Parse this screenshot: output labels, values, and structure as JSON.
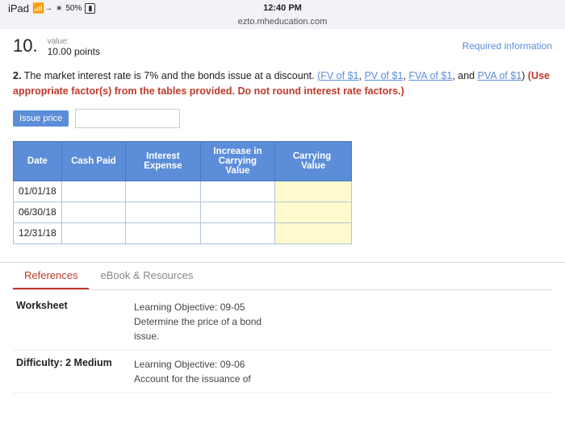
{
  "statusBar": {
    "left": "iPad",
    "time": "12:40 PM",
    "url": "ezto.mheducation.com",
    "battery": "50%",
    "wifiIcon": "wifi",
    "batteryIcon": "battery"
  },
  "question": {
    "number": "10.",
    "valueLabel": "value:",
    "points": "10.00 points",
    "requiredInfo": "Required information",
    "body": "2. The market interest rate is 7% and the bonds issue at a discount.",
    "links": [
      "(FV of $1",
      "PV of $1",
      "FVA of $1",
      "PVA of $1)"
    ],
    "warning": "(Use appropriate factor(s) from the tables provided. Do not round interest rate factors.)",
    "issuePriceLabel": "Issue price",
    "issuePricePlaceholder": ""
  },
  "table": {
    "headers": [
      "Date",
      "Cash Paid",
      "Interest\nExpense",
      "Increase in\nCarrying Value",
      "Carrying  Value"
    ],
    "rows": [
      {
        "date": "01/01/18",
        "cashPaid": "",
        "interestExpense": "",
        "increaseCarrying": "",
        "carryingValue": ""
      },
      {
        "date": "06/30/18",
        "cashPaid": "",
        "interestExpense": "",
        "increaseCarrying": "",
        "carryingValue": ""
      },
      {
        "date": "12/31/18",
        "cashPaid": "",
        "interestExpense": "",
        "increaseCarrying": "",
        "carryingValue": ""
      }
    ]
  },
  "tabs": [
    {
      "id": "references",
      "label": "References",
      "active": true
    },
    {
      "id": "ebook",
      "label": "eBook & Resources",
      "active": false
    }
  ],
  "references": [
    {
      "label": "Worksheet",
      "desc": "Learning Objective: 09-05\nDetermine the price of a bond issue."
    },
    {
      "label": "Difficulty: 2 Medium",
      "desc": "Learning Objective: 09-06\nAccount for the issuance of"
    }
  ]
}
